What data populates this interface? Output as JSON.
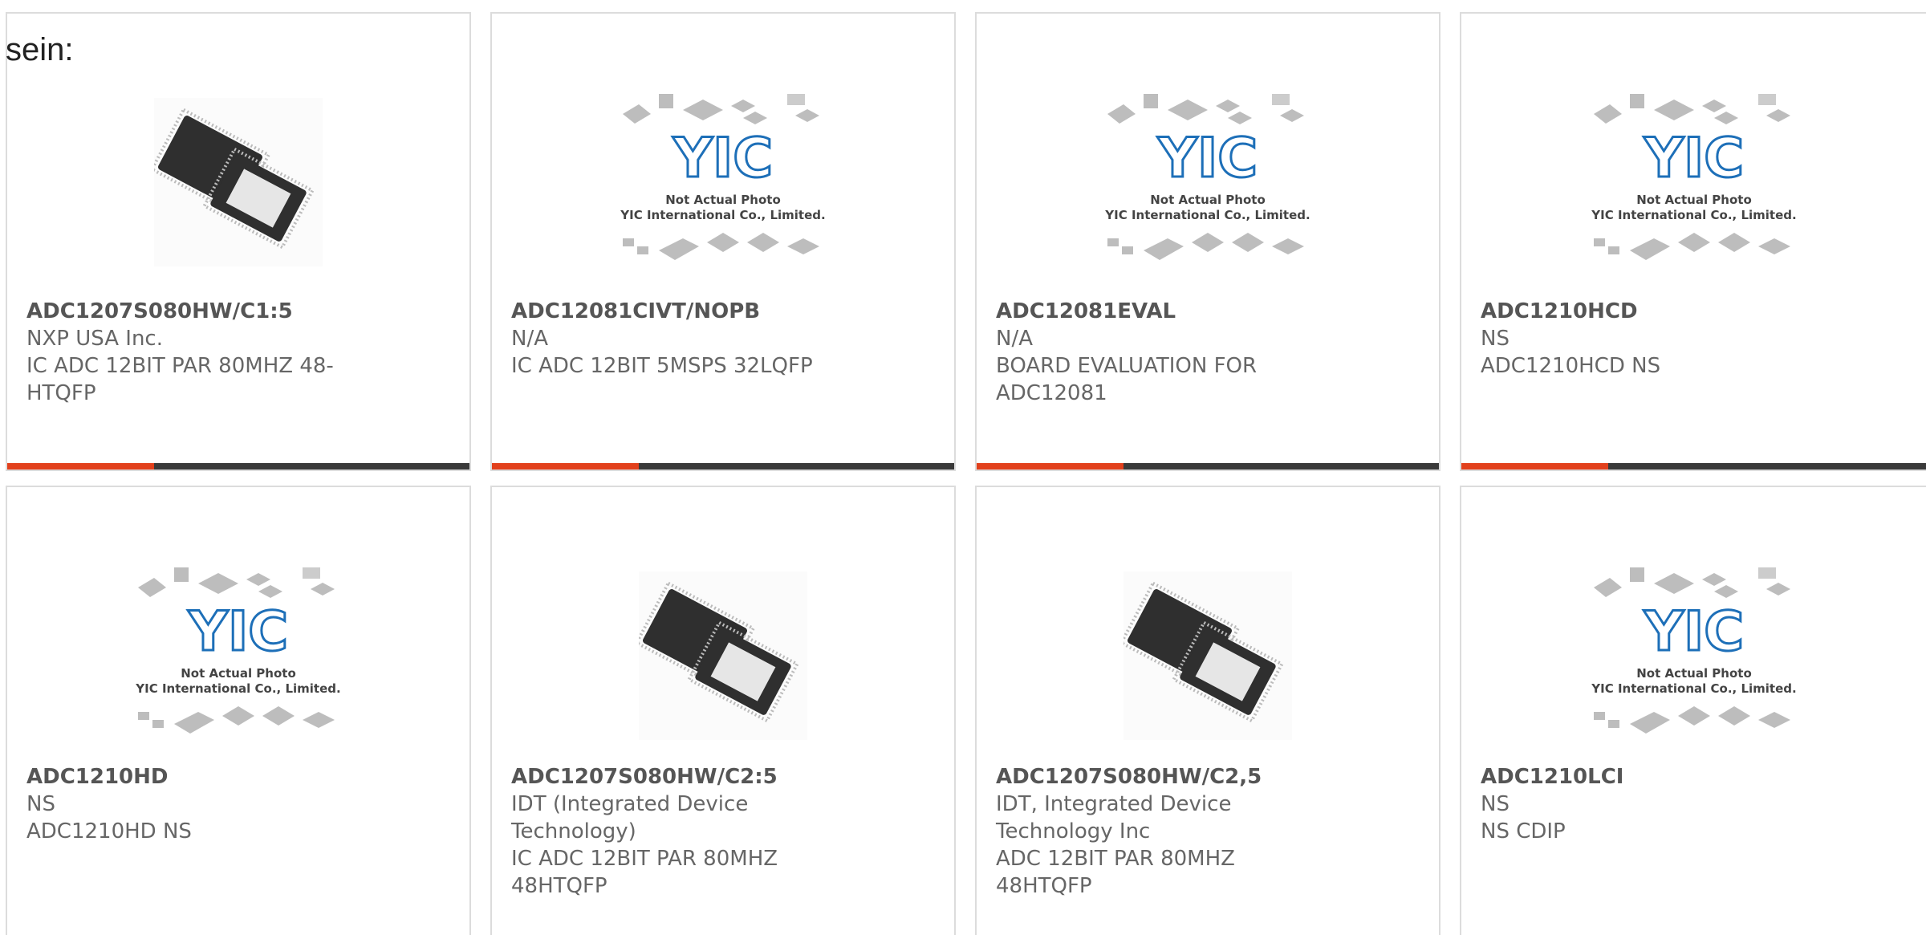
{
  "intro_text": "sein:",
  "products": [
    {
      "part": "ADC1207S080HW/C1:5",
      "maker": "NXP USA Inc.",
      "desc": "IC ADC 12BIT PAR 80MHZ 48-HTQFP",
      "image": "chip-photo"
    },
    {
      "part": "ADC12081CIVT/NOPB",
      "maker": "N/A",
      "desc": "IC ADC 12BIT 5MSPS 32LQFP",
      "image": "placeholder"
    },
    {
      "part": "ADC12081EVAL",
      "maker": "N/A",
      "desc": "BOARD EVALUATION FOR ADC12081",
      "image": "placeholder"
    },
    {
      "part": "ADC1210HCD",
      "maker": "NS",
      "desc": "ADC1210HCD NS",
      "image": "placeholder"
    },
    {
      "part": "ADC1210HD",
      "maker": "NS",
      "desc": "ADC1210HD NS",
      "image": "placeholder"
    },
    {
      "part": "ADC1207S080HW/C2:5",
      "maker": "IDT (Integrated Device Technology)",
      "desc": "IC ADC 12BIT PAR 80MHZ 48HTQFP",
      "image": "chip-photo"
    },
    {
      "part": "ADC1207S080HW/C2,5",
      "maker": "IDT, Integrated Device Technology Inc",
      "desc": "ADC 12BIT PAR 80MHZ 48HTQFP",
      "image": "chip-photo"
    },
    {
      "part": "ADC1210LCI",
      "maker": "NS",
      "desc": "NS CDIP",
      "image": "placeholder"
    }
  ],
  "placeholder_caption": {
    "line1": "Not Actual Photo",
    "line2": "YIC International Co., Limited.",
    "logo": "YIC"
  },
  "colors": {
    "accent": "#e2401c",
    "bar": "#3a3a3a",
    "logo": "#1d6fb8"
  }
}
